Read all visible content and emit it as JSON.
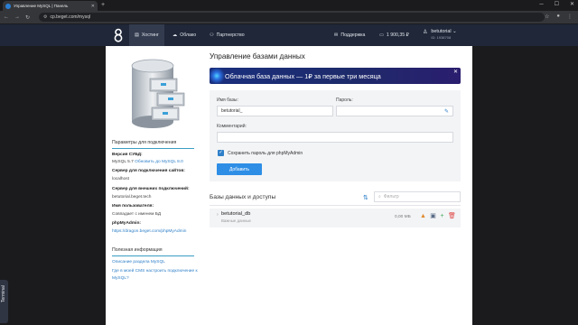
{
  "browser": {
    "tab_title": "Управление MySQL | Панель",
    "url": "cp.beget.com/mysql"
  },
  "header": {
    "nav": [
      {
        "label": "Хостинг",
        "icon": "server-icon",
        "active": true
      },
      {
        "label": "Облако",
        "icon": "cloud-icon",
        "active": false
      },
      {
        "label": "Партнерство",
        "icon": "partners-icon",
        "active": false
      }
    ],
    "support_label": "Поддержка",
    "balance": "1 900,35 ₽",
    "user_name": "betutorial",
    "user_id": "ID: 1938708"
  },
  "sidebar": {
    "section_title": "Параметры для подключения",
    "dbms_label": "Версия СУБД:",
    "dbms_value": "MySQL 5.7",
    "dbms_link": "Обновить до MySQL 8.0",
    "site_server_label": "Сервер для подключения сайтов:",
    "site_server_value": "localhost",
    "ext_server_label": "Сервер для внешних подключений:",
    "ext_server_value": "betutorial.beget.tech",
    "user_label": "Имя пользователя:",
    "user_value": "Совпадает с именем БД",
    "pma_label": "phpMyAdmin:",
    "pma_value": "https://dragon.beget.com/phpMyAdmin",
    "useful_title": "Полезная информация",
    "useful_link1": "Описание раздела MySQL",
    "useful_link2": "Где в моей CMS настроить подключение к MySQL?"
  },
  "main": {
    "title": "Управление базами данных",
    "promo_text": "Облачная база данных — 1₽ за первые три месяца",
    "db_name_label": "Имя базы:",
    "db_name_value": "betutorial_",
    "password_label": "Пароль:",
    "password_value": "",
    "comment_label": "Комментарий:",
    "comment_value": "",
    "save_pass_label": "Сохранить пароль для phpMyAdmin",
    "save_pass_checked": true,
    "add_button": "Добавить",
    "list_title": "Базы данных и доступы",
    "filter_placeholder": "Фильтр",
    "databases": [
      {
        "name": "betutorial_db",
        "subtitle": "Важные данные",
        "size": "0,00 МБ"
      }
    ]
  },
  "terminal_label": "Terminal",
  "colors": {
    "header_bg": "#1f2738",
    "accent": "#2e8ee6",
    "link": "#2e7fc8",
    "promo_bg": "#1e2b6b"
  }
}
